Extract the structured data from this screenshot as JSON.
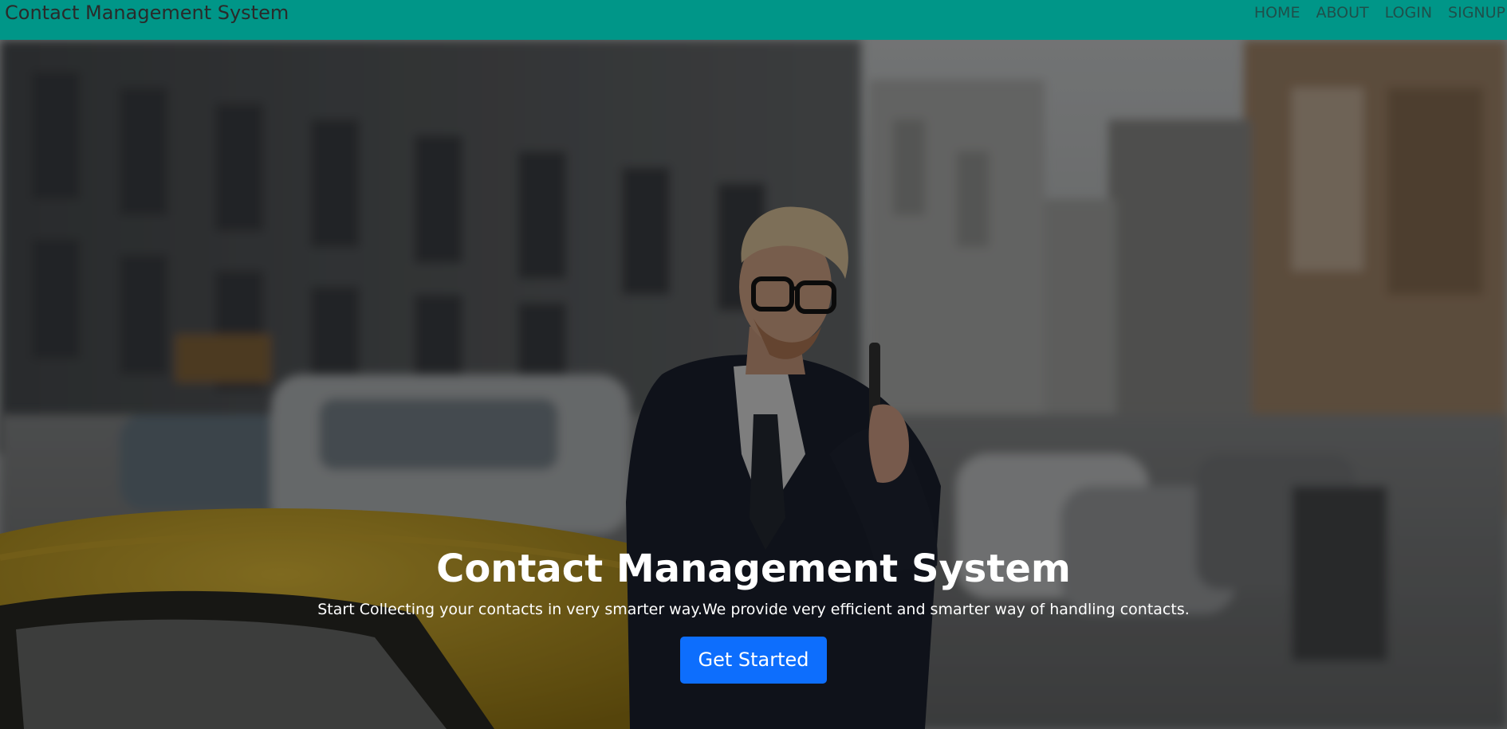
{
  "navbar": {
    "brand": "Contact Management System",
    "links": [
      "HOME",
      "ABOUT",
      "LOGIN",
      "SIGNUP"
    ],
    "background_color": "#009688"
  },
  "hero": {
    "title": "Contact Management System",
    "subtitle": "Start Collecting your contacts in very smarter way.We provide very efficient and smarter way of handling contacts.",
    "cta_label": "Get Started",
    "cta_color": "#0d6efd",
    "background_image": "man-on-phone-street-photo"
  }
}
